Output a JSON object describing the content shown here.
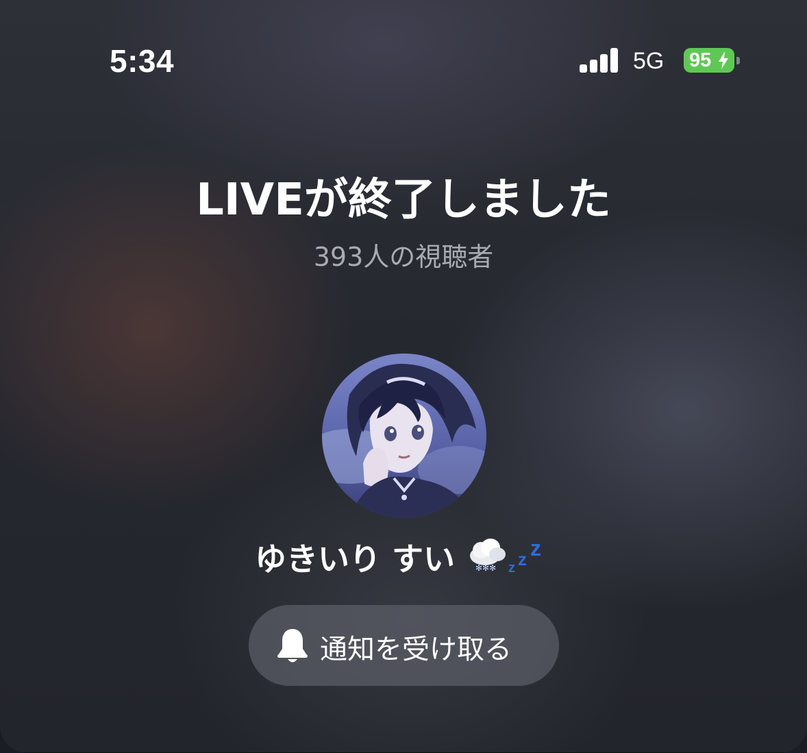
{
  "status_bar": {
    "time": "5:34",
    "network": "5G",
    "battery_level": "95",
    "battery_color": "#5fc855"
  },
  "live_end": {
    "title": "LIVEが終了しました",
    "viewers": "393人の視聴者"
  },
  "host": {
    "name": "ゆきいり すい",
    "avatar_icon": "anime-character-avatar",
    "name_emojis": [
      "cloud-with-snow-icon",
      "zzz-icon"
    ]
  },
  "notify_button": {
    "label": "通知を受け取る",
    "icon": "bell-icon"
  }
}
